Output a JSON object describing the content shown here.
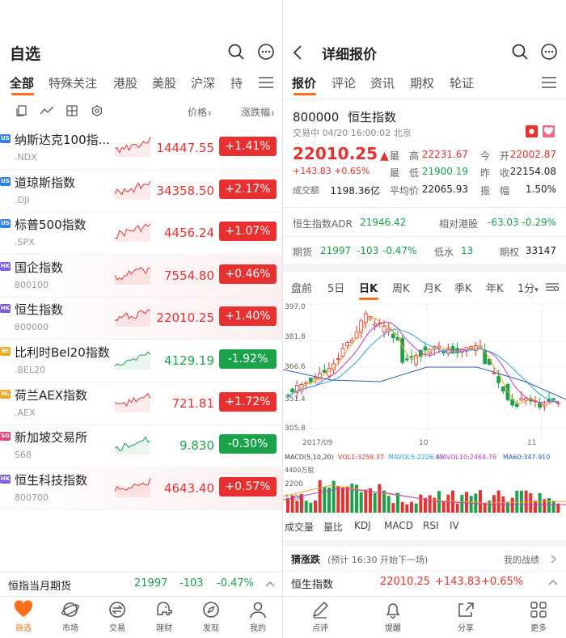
{
  "left": {
    "title": "自选",
    "tabs": [
      "全部",
      "特殊关注",
      "港股",
      "美股",
      "沪深",
      "持"
    ],
    "list_header": {
      "price": "价格",
      "change": "涨跌幅"
    },
    "rows": [
      {
        "badge": "US",
        "name": "纳斯达克100指...",
        "code": ".NDX",
        "price": "14447.55",
        "change": "+1.41%",
        "dir": "up"
      },
      {
        "badge": "US",
        "name": "道琼斯指数",
        "code": ".DJI",
        "price": "34358.50",
        "change": "+2.17%",
        "dir": "up"
      },
      {
        "badge": "US",
        "name": "标普500指数",
        "code": ".SPX",
        "price": "4456.24",
        "change": "+1.07%",
        "dir": "up"
      },
      {
        "badge": "HK",
        "name": "国企指数",
        "code": "800100",
        "price": "7554.80",
        "change": "+0.46%",
        "dir": "up"
      },
      {
        "badge": "HK",
        "name": "恒生指数",
        "code": "800000",
        "price": "22010.25",
        "change": "+1.40%",
        "dir": "up"
      },
      {
        "badge": "BE",
        "name": "比利时Bel20指数",
        "code": ".BEL20",
        "price": "4129.19",
        "change": "-1.92%",
        "dir": "dn"
      },
      {
        "badge": "NL",
        "name": "荷兰AEX指数",
        "code": ".AEX",
        "price": "721.81",
        "change": "+1.72%",
        "dir": "up"
      },
      {
        "badge": "SG",
        "name": "新加坡交易所",
        "code": "S68",
        "price": "9.830",
        "change": "-0.30%",
        "dir": "dn"
      },
      {
        "badge": "HK",
        "name": "恒生科技指数",
        "code": "800700",
        "price": "4643.40",
        "change": "+0.57%",
        "dir": "up"
      }
    ],
    "futures_bar": {
      "name": "恒指当月期货",
      "price": "21997",
      "change": "-103",
      "pct": "-0.47%"
    },
    "nav": [
      "自选",
      "市场",
      "交易",
      "理财",
      "发现",
      "我的"
    ]
  },
  "right": {
    "title": "详细报价",
    "tabs": [
      "报价",
      "评论",
      "资讯",
      "期权",
      "轮证"
    ],
    "code": "800000",
    "name": "恒生指数",
    "status": "交易中 04/20 16:00:02 北京",
    "price": "22010.25",
    "change": "+143.83",
    "pct": "+0.65%",
    "stats": [
      {
        "k": "最　高",
        "v": "22231.67",
        "c": "up"
      },
      {
        "k": "今　开",
        "v": "22002.87",
        "c": "up"
      },
      {
        "k": "最　低",
        "v": "21900.19",
        "c": "dn"
      },
      {
        "k": "昨　收",
        "v": "22154.08",
        "c": ""
      },
      {
        "k": "成交额",
        "v": "1198.36亿",
        "c": ""
      },
      {
        "k": "平均价",
        "v": "22065.93",
        "c": ""
      },
      {
        "k": "振　幅",
        "v": "1.50%",
        "c": ""
      }
    ],
    "adr": {
      "label": "恒生指数ADR",
      "value": "21946.42",
      "rel_label": "相对港股",
      "rel_change": "-63.03",
      "rel_pct": "-0.29%"
    },
    "futures": {
      "label": "期货",
      "price": "21997",
      "change": "-103",
      "pct": "-0.47%",
      "low_label": "低水",
      "low": "13",
      "opt_label": "期权",
      "opt": "33147"
    },
    "period_tabs": [
      "盘前",
      "5日",
      "日K",
      "周K",
      "月K",
      "季K",
      "年K",
      "1分"
    ],
    "chart": {
      "y_labels": [
        "397.0",
        "381.8",
        "366.6",
        "351.4",
        "305.8"
      ],
      "x_labels": [
        "2017/09",
        "10",
        "11"
      ],
      "macd_legend": {
        "label": "MACD(5,10,20)",
        "vol": "VOL1:3258.37",
        "ma5": "MAVOL5:2226.62",
        "ma10": "MAVOL10:2464.76",
        "ma60": "MA60:347.910"
      },
      "vol_unit": "4400万股",
      "vol_y": [
        "2200",
        "1100"
      ],
      "indicators": [
        "成交量",
        "量比",
        "KDJ",
        "MACD",
        "RSI",
        "IV"
      ],
      "colors": {
        "up": "#e93030",
        "down": "#1aa34a",
        "ma5": "#f4a020",
        "ma10": "#c040c0",
        "ma20": "#2aa8e0",
        "ma60": "#3060b0"
      }
    },
    "guess": {
      "title": "猜涨跌",
      "sub": "(预计 16:30 开始下一场)",
      "link": "我的战绩"
    },
    "bottom_quote": {
      "name": "恒生指数",
      "price": "22010.25",
      "change": "+143.83",
      "pct": "+0.65%"
    },
    "nav": [
      "点评",
      "提醒",
      "分享",
      "更多"
    ]
  },
  "colors": {
    "accent": "#ff6f1a",
    "up": "#e93030",
    "down": "#1aa34a"
  }
}
